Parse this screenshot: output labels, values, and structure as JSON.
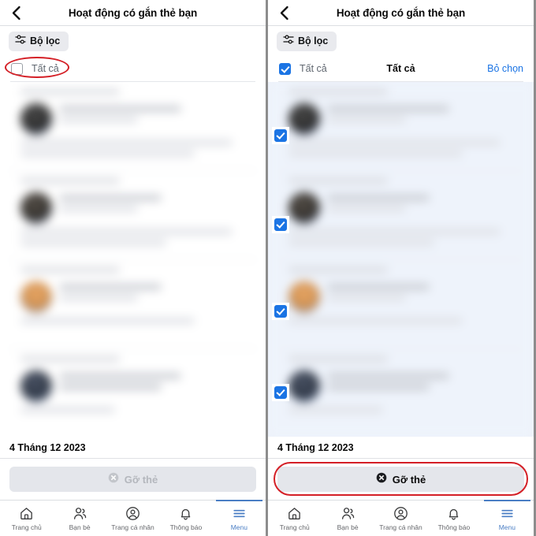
{
  "screens": [
    {
      "id": "before-selection",
      "header": {
        "title": "Hoạt động có gắn thẻ bạn",
        "back_icon": "chevron-left-icon"
      },
      "filter": {
        "label": "Bộ lọc",
        "icon": "sliders-icon"
      },
      "select_all": {
        "label": "Tất cả",
        "checked": false,
        "center_label": "",
        "action_label": "",
        "annotated": true
      },
      "posts": [
        {
          "checked": false,
          "avatar": "a1"
        },
        {
          "checked": false,
          "avatar": "a2"
        },
        {
          "checked": false,
          "avatar": "a3"
        },
        {
          "checked": false,
          "avatar": "a4"
        }
      ],
      "date_label": "4 Tháng 12 2023",
      "action": {
        "label": "Gỡ thẻ",
        "icon": "circle-x-icon",
        "enabled": false,
        "annotated": false
      }
    },
    {
      "id": "after-selection",
      "header": {
        "title": "Hoạt động có gắn thẻ bạn",
        "back_icon": "chevron-left-icon"
      },
      "filter": {
        "label": "Bộ lọc",
        "icon": "sliders-icon"
      },
      "select_all": {
        "label": "Tất cả",
        "checked": true,
        "center_label": "Tất cả",
        "action_label": "Bỏ chọn",
        "annotated": false
      },
      "posts": [
        {
          "checked": true,
          "avatar": "a1"
        },
        {
          "checked": true,
          "avatar": "a2"
        },
        {
          "checked": true,
          "avatar": "a3"
        },
        {
          "checked": true,
          "avatar": "a4"
        }
      ],
      "date_label": "4 Tháng 12 2023",
      "action": {
        "label": "Gỡ thẻ",
        "icon": "circle-x-icon",
        "enabled": true,
        "annotated": true
      }
    }
  ],
  "tabbar": {
    "items": [
      {
        "label": "Trang chủ",
        "icon": "home-icon",
        "active": false
      },
      {
        "label": "Bạn bè",
        "icon": "friends-icon",
        "active": false
      },
      {
        "label": "Trang cá nhân",
        "icon": "profile-icon",
        "active": false
      },
      {
        "label": "Thông báo",
        "icon": "bell-icon",
        "active": false
      },
      {
        "label": "Menu",
        "icon": "menu-icon",
        "active": true
      }
    ]
  },
  "colors": {
    "accent_blue": "#1b74e4",
    "annotation_red": "#d41f26",
    "chip_gray": "#e9eaee",
    "disabled_text": "#b4b7bd",
    "tab_active": "#4a7ec4"
  }
}
